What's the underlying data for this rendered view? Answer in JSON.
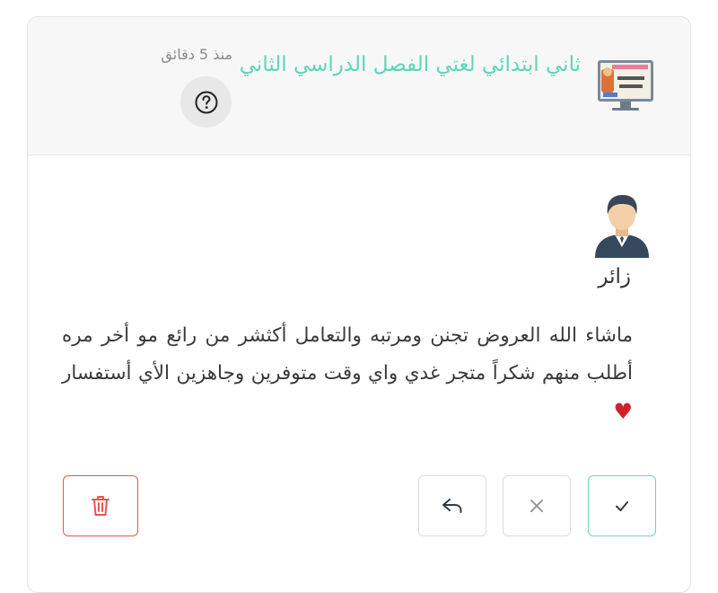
{
  "review": {
    "product_title": "ثاني ابتدائي لغتي الفصل الدراسي الثاني",
    "time_ago": "منذ 5 دقائق",
    "author": "زائر",
    "text": "ماشاء الله العروض تجنن ومرتبه والتعامل أكثشر من رائع مو أخر مره أطلب منهم شكراً متجر غدي واي وقت متوفرين وجاهزين الأي أستفسار",
    "heart": "♥"
  },
  "icons": {
    "help": "question-circle-icon",
    "approve": "check-icon",
    "reject": "close-icon",
    "reply": "reply-icon",
    "delete": "trash-icon"
  },
  "colors": {
    "accent": "#5fd4b8",
    "danger": "#e4564f",
    "header_bg": "#f7f7f7"
  }
}
